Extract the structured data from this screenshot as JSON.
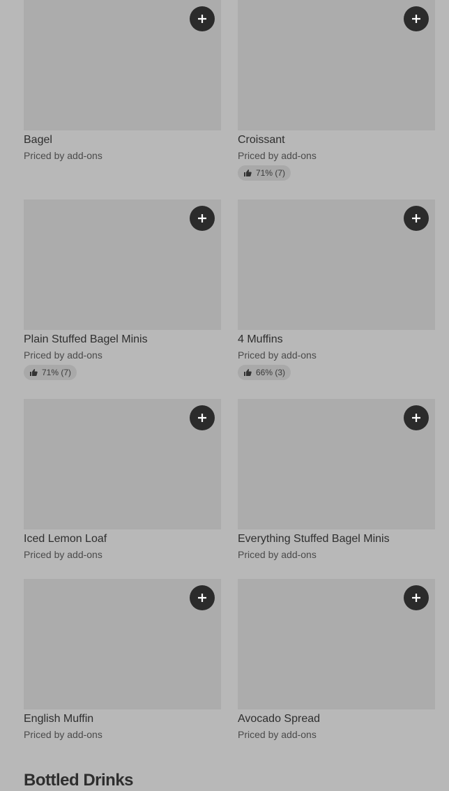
{
  "menu": {
    "items": [
      {
        "name": "Bagel",
        "price": "Priced by add-ons",
        "rating": null
      },
      {
        "name": "Croissant",
        "price": "Priced by add-ons",
        "rating": "71% (7)"
      },
      {
        "name": "Plain Stuffed Bagel Minis",
        "price": "Priced by add-ons",
        "rating": "71% (7)"
      },
      {
        "name": "4 Muffins",
        "price": "Priced by add-ons",
        "rating": "66% (3)"
      },
      {
        "name": "Iced Lemon Loaf",
        "price": "Priced by add-ons",
        "rating": null
      },
      {
        "name": "Everything Stuffed Bagel Minis",
        "price": "Priced by add-ons",
        "rating": null
      },
      {
        "name": "English Muffin",
        "price": "Priced by add-ons",
        "rating": null
      },
      {
        "name": "Avocado Spread",
        "price": "Priced by add-ons",
        "rating": null
      }
    ]
  },
  "next_section": {
    "title": "Bottled Drinks"
  },
  "icons": {
    "add": "plus-icon",
    "rating": "thumbs-up-icon"
  },
  "colors": {
    "overlay_background": "#b8b8b8",
    "thumbnail": "#acacac",
    "add_button": "#2b2b2b",
    "rating_pill": "#a9a9a9"
  }
}
